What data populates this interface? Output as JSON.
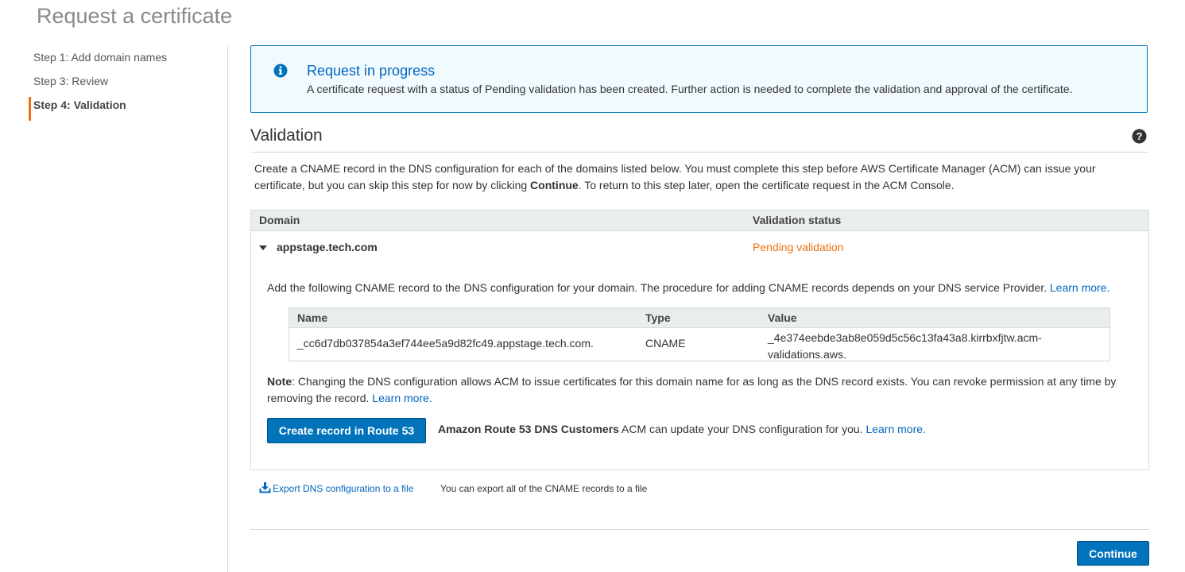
{
  "page": {
    "title": "Request a certificate"
  },
  "steps": [
    {
      "label": "Step 1: Add domain names",
      "active": false
    },
    {
      "label": "Step 3: Review",
      "active": false
    },
    {
      "label": "Step 4: Validation",
      "active": true
    }
  ],
  "alert": {
    "title": "Request in progress",
    "message": "A certificate request with a status of Pending validation has been created. Further action is needed to complete the validation and approval of the certificate.",
    "icon": "info-icon"
  },
  "validation": {
    "title": "Validation",
    "intro_part1": "Create a CNAME record in the DNS configuration for each of the domains listed below. You must complete this step before AWS Certificate Manager (ACM) can issue your certificate, but you can skip this step for now by clicking ",
    "intro_bold": "Continue",
    "intro_part2": ". To return to this step later, open the certificate request in the ACM Console."
  },
  "table": {
    "headers": {
      "domain": "Domain",
      "status": "Validation status"
    },
    "row": {
      "domain": "appstage.tech.com",
      "status": "Pending validation",
      "detail_text": "Add the following CNAME record to the DNS configuration for your domain. The procedure for adding CNAME records depends on your DNS service Provider. ",
      "detail_link": "Learn more.",
      "cname_headers": {
        "name": "Name",
        "type": "Type",
        "value": "Value"
      },
      "cname": {
        "name": "_cc6d7db037854a3ef744ee5a9d82fc49.appstage.tech.com.",
        "type": "CNAME",
        "value": "_4e374eebde3ab8e059d5c56c13fa43a8.kirrbxfjtw.acm-validations.aws."
      },
      "note_label": "Note",
      "note_text": ": Changing the DNS configuration allows ACM to issue certificates for this domain name for as long as the DNS record exists. You can revoke permission at any time by removing the record. ",
      "note_link": "Learn more.",
      "route_button": "Create record in Route 53",
      "route_bold": "Amazon Route 53 DNS Customers",
      "route_text": " ACM can update your DNS configuration for you. ",
      "route_link": "Learn more."
    }
  },
  "export": {
    "link": "Export DNS configuration to a file",
    "description": "You can export all of the CNAME records to a file"
  },
  "footer": {
    "continue": "Continue"
  },
  "colors": {
    "accent": "#0073bb",
    "link": "#0066c0",
    "pending": "#ec7211",
    "active_step": "#ec7211"
  }
}
